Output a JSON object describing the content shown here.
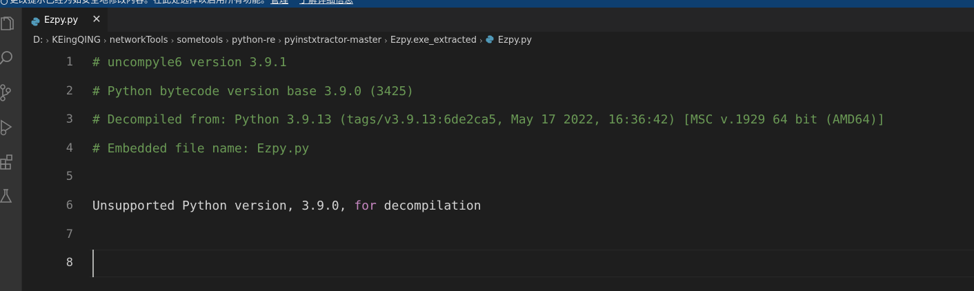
{
  "notification": {
    "text": "更改提示已经为如安全地修改内容。在此处选择以启用所有功能。",
    "link_manage": "管理",
    "link_learn": "了解详细信息"
  },
  "activity_bar": {
    "items": [
      {
        "name": "explorer-icon"
      },
      {
        "name": "search-icon"
      },
      {
        "name": "source-control-icon"
      },
      {
        "name": "run-debug-icon"
      },
      {
        "name": "extensions-icon"
      },
      {
        "name": "testing-icon"
      }
    ]
  },
  "tab": {
    "label": "Ezpy.py",
    "close": "✕",
    "icon": "python-file-icon"
  },
  "breadcrumb": {
    "items": [
      "D:",
      "KEingQING",
      "networkTools",
      "sometools",
      "python-re",
      "pyinstxtractor-master",
      "Ezpy.exe_extracted",
      "Ezpy.py"
    ],
    "separator": "›"
  },
  "editor": {
    "lines": [
      {
        "num": "1",
        "text": "# uncompyle6 version 3.9.1"
      },
      {
        "num": "2",
        "text": "# Python bytecode version base 3.9.0 (3425)"
      },
      {
        "num": "3",
        "text": "# Decompiled from: Python 3.9.13 (tags/v3.9.13:6de2ca5, May 17 2022, 16:36:42) [MSC v.1929 64 bit (AMD64)]"
      },
      {
        "num": "4",
        "text": "# Embedded file name: Ezpy.py"
      },
      {
        "num": "5",
        "text": ""
      },
      {
        "num": "6",
        "text_a": "Unsupported Python version, 3.9.0, ",
        "text_kw": "for",
        "text_b": " decompilation"
      },
      {
        "num": "7",
        "text": ""
      },
      {
        "num": "8",
        "text": ""
      }
    ],
    "active_line": 8
  },
  "colors": {
    "comment": "#6a9955",
    "keyword": "#c586c0",
    "text": "#d4d4d4",
    "background": "#1e1e1e"
  }
}
